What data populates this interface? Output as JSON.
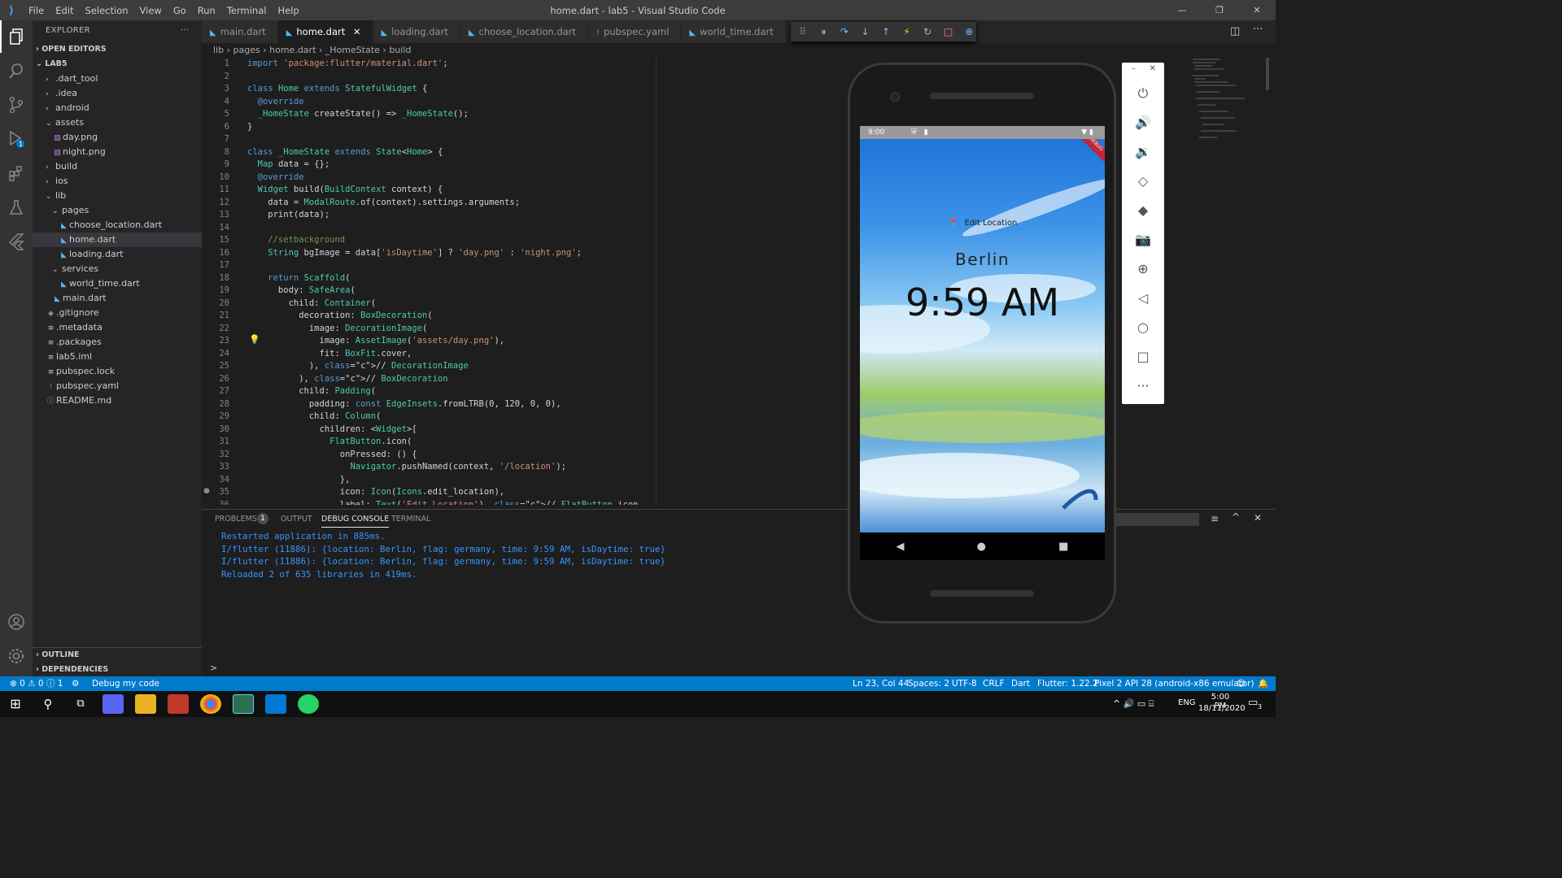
{
  "window": {
    "title": "home.dart - lab5 - Visual Studio Code",
    "menu": [
      "File",
      "Edit",
      "Selection",
      "View",
      "Go",
      "Run",
      "Terminal",
      "Help"
    ]
  },
  "explorer": {
    "title": "EXPLORER",
    "open_editors": "OPEN EDITORS",
    "project": "LAB5",
    "tree": [
      {
        "label": ".dart_tool",
        "kind": "folder",
        "depth": 1,
        "open": false
      },
      {
        "label": ".idea",
        "kind": "folder",
        "depth": 1,
        "open": false
      },
      {
        "label": "android",
        "kind": "folder",
        "depth": 1,
        "open": false
      },
      {
        "label": "assets",
        "kind": "folder",
        "depth": 1,
        "open": true
      },
      {
        "label": "day.png",
        "kind": "image",
        "depth": 2
      },
      {
        "label": "night.png",
        "kind": "image",
        "depth": 2
      },
      {
        "label": "build",
        "kind": "folder",
        "depth": 1,
        "open": false
      },
      {
        "label": "ios",
        "kind": "folder",
        "depth": 1,
        "open": false
      },
      {
        "label": "lib",
        "kind": "folder",
        "depth": 1,
        "open": true
      },
      {
        "label": "pages",
        "kind": "folder",
        "depth": 2,
        "open": true
      },
      {
        "label": "choose_location.dart",
        "kind": "dart",
        "depth": 3
      },
      {
        "label": "home.dart",
        "kind": "dart",
        "depth": 3,
        "selected": true
      },
      {
        "label": "loading.dart",
        "kind": "dart",
        "depth": 3
      },
      {
        "label": "services",
        "kind": "folder",
        "depth": 2,
        "open": true
      },
      {
        "label": "world_time.dart",
        "kind": "dart",
        "depth": 3
      },
      {
        "label": "main.dart",
        "kind": "dart",
        "depth": 2
      },
      {
        "label": ".gitignore",
        "kind": "git",
        "depth": 1
      },
      {
        "label": ".metadata",
        "kind": "text",
        "depth": 1
      },
      {
        "label": ".packages",
        "kind": "text",
        "depth": 1
      },
      {
        "label": "lab5.iml",
        "kind": "text",
        "depth": 1
      },
      {
        "label": "pubspec.lock",
        "kind": "text",
        "depth": 1
      },
      {
        "label": "pubspec.yaml",
        "kind": "yaml",
        "depth": 1
      },
      {
        "label": "README.md",
        "kind": "info",
        "depth": 1
      }
    ],
    "outline": "OUTLINE",
    "dependencies": "DEPENDENCIES"
  },
  "tabs": [
    {
      "label": "main.dart",
      "active": false
    },
    {
      "label": "home.dart",
      "active": true
    },
    {
      "label": "loading.dart",
      "active": false
    },
    {
      "label": "choose_location.dart",
      "active": false
    },
    {
      "label": "pubspec.yaml",
      "active": false,
      "icon": "!"
    },
    {
      "label": "world_time.dart",
      "active": false
    }
  ],
  "breadcrumb": [
    "lib",
    "pages",
    "home.dart",
    "_HomeState",
    "build"
  ],
  "code_lines": [
    "import 'package:flutter/material.dart';",
    "",
    "class Home extends StatefulWidget {",
    "  @override",
    "  _HomeState createState() => _HomeState();",
    "}",
    "",
    "class _HomeState extends State<Home> {",
    "  Map data = {};",
    "  @override",
    "  Widget build(BuildContext context) {",
    "    data = ModalRoute.of(context).settings.arguments;",
    "    print(data);",
    "",
    "    //setbackground",
    "    String bgImage = data['isDaytime'] ? 'day.png' : 'night.png';",
    "",
    "    return Scaffold(",
    "      body: SafeArea(",
    "        child: Container(",
    "          decoration: BoxDecoration(",
    "            image: DecorationImage(",
    "              image: AssetImage('assets/day.png'),",
    "              fit: BoxFit.cover,",
    "            ), // DecorationImage",
    "          ), // BoxDecoration",
    "          child: Padding(",
    "            padding: const EdgeInsets.fromLTRB(0, 120, 0, 0),",
    "            child: Column(",
    "              children: <Widget>[",
    "                FlatButton.icon(",
    "                  onPressed: () {",
    "                    Navigator.pushNamed(context, '/location');",
    "                  },",
    "                  icon: Icon(Icons.edit_location),",
    "                  label: Text('Edit Location'), // FlatButton.icon"
  ],
  "panel": {
    "tabs": [
      "PROBLEMS",
      "OUTPUT",
      "DEBUG CONSOLE",
      "TERMINAL"
    ],
    "problems_count": "1",
    "console": [
      "Restarted application in 885ms.",
      "I/flutter (11886): {location: Berlin, flag: germany, time: 9:59 AM, isDaytime: true}",
      "I/flutter (11886): {location: Berlin, flag: germany, time: 9:59 AM, isDaytime: true}",
      "Reloaded 2 of 635 libraries in 419ms."
    ],
    "prompt": ">"
  },
  "status": {
    "errors": "0",
    "warnings": "0",
    "infos": "1",
    "debug": "Debug my code",
    "position": "Ln 23, Col 44",
    "spaces": "Spaces: 2",
    "encoding": "UTF-8",
    "eol": "CRLF",
    "language": "Dart",
    "flutter": "Flutter: 1.22.2",
    "device": "Pixel 2 API 28 (android-x86 emulator)"
  },
  "phone": {
    "time": "9:00",
    "edit_location": "Edit Location",
    "city": "Berlin",
    "clock": "9:59 AM",
    "debug_banner": "DEBUG"
  },
  "taskbar": {
    "lang": "ENG",
    "time": "5:00 PM",
    "date": "18/11/2020",
    "notif": "3"
  },
  "colors": {
    "accent": "#007acc",
    "titlebar": "#3c3c3c"
  }
}
